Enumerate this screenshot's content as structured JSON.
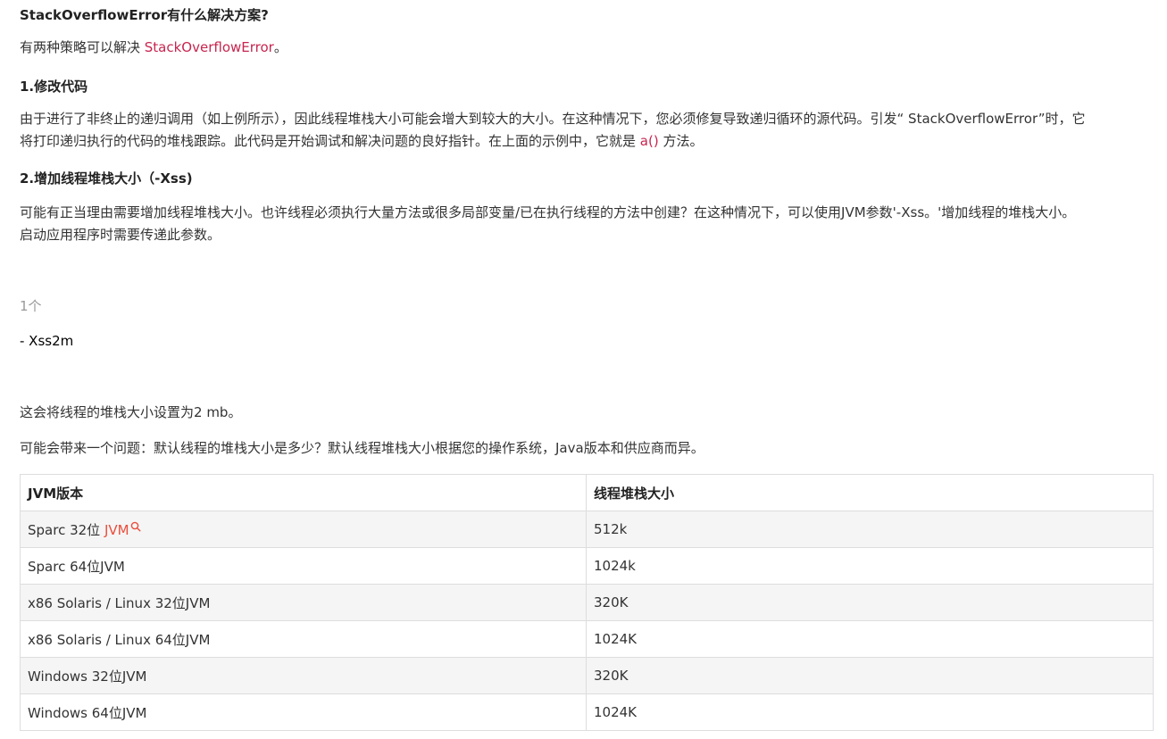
{
  "heading": "StackOverflowError有什么解决方案?",
  "intro": {
    "text_before": "有两种策略可以解决 ",
    "code": "StackOverflowError",
    "text_after": "。"
  },
  "section1": {
    "title": "1.修改代码",
    "para_line1": "由于进行了非终止的递归调用（如上例所示），因此线程堆栈大小可能会增大到较大的大小。在这种情况下，您必须修复导致递归循环的源代码。引发“ StackOverflowError”时，它",
    "para_line2_before": "将打印递归执行的代码的堆栈跟踪。此代码是开始调试和解决问题的良好指针。在上面的示例中，它就是 ",
    "para_code": "a()",
    "para_line2_after": " 方法。"
  },
  "section2": {
    "title": "2.增加线程堆栈大小（-Xss)",
    "para_line1": "可能有正当理由需要增加线程堆栈大小。也许线程必须执行大量方法或很多局部变量/已在执行线程的方法中创建？在这种情况下，可以使用JVM参数'-Xss。'增加线程的堆栈大小。",
    "para_line2": "启动应用程序时需要传递此参数。"
  },
  "code_block": {
    "line_number": "1个",
    "line": "- Xss2m"
  },
  "after_code": "这会将线程的堆栈大小设置为2 mb。",
  "question": "可能会带来一个问题：默认线程的堆栈大小是多少？默认线程堆栈大小根据您的操作系统，Java版本和供应商而异。",
  "table": {
    "headers": [
      "JVM版本",
      "线程堆栈大小"
    ],
    "rows": [
      {
        "jvm_prefix": "Sparc 32位 ",
        "jvm_link": "JVM",
        "size": "512k"
      },
      {
        "jvm": "Sparc 64位JVM",
        "size": "1024k"
      },
      {
        "jvm": "x86 Solaris / Linux 32位JVM",
        "size": "320K"
      },
      {
        "jvm": "x86 Solaris / Linux 64位JVM",
        "size": "1024K"
      },
      {
        "jvm": "Windows 32位JVM",
        "size": "320K"
      },
      {
        "jvm": "Windows 64位JVM",
        "size": "1024K"
      }
    ]
  },
  "colors": {
    "code_red": "#c7254e",
    "link_red": "#e94e3c",
    "stripe": "#f5f5f5",
    "border": "#dddddd"
  }
}
